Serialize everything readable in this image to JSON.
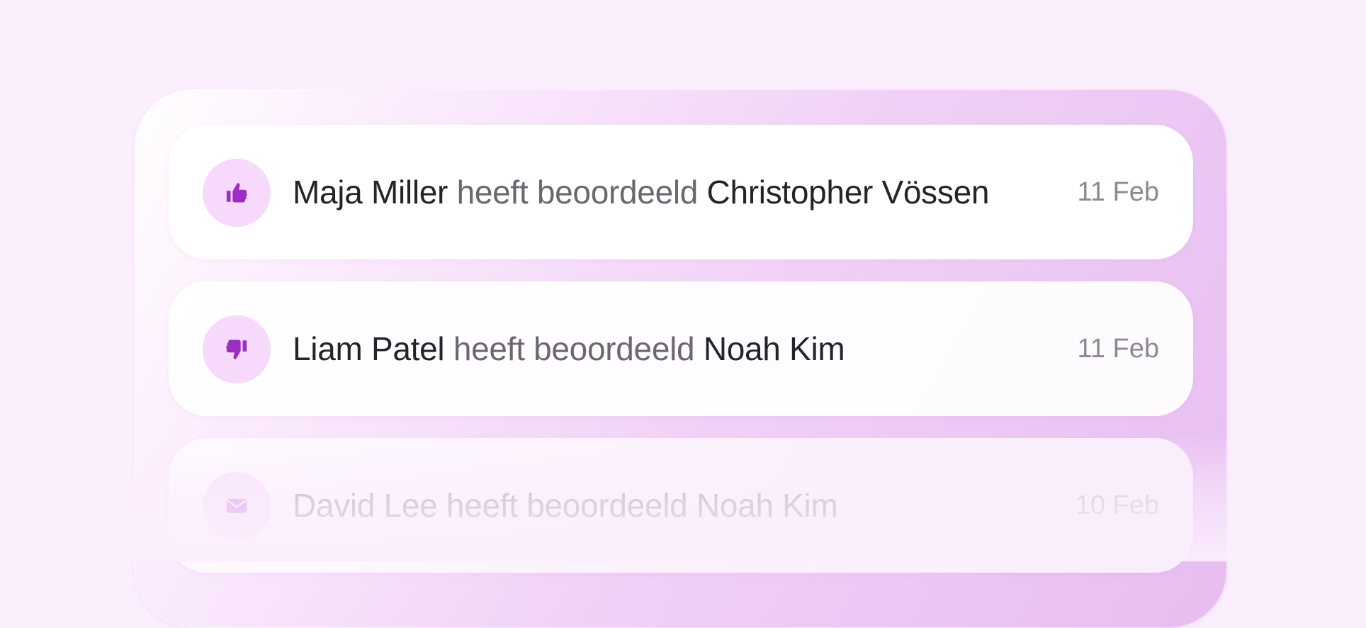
{
  "activity": {
    "items": [
      {
        "icon": "thumbs-up-icon",
        "actor": "Maja Miller",
        "verb": "heeft beoordeeld",
        "target": "Christopher Vössen",
        "date": "11 Feb"
      },
      {
        "icon": "thumbs-down-icon",
        "actor": "Liam Patel",
        "verb": "heeft beoordeeld",
        "target": "Noah Kim",
        "date": "11 Feb"
      },
      {
        "icon": "mail-icon",
        "actor": "David Lee",
        "verb": "heeft beoordeeld",
        "target": "Noah Kim",
        "date": "10 Feb"
      }
    ]
  },
  "colors": {
    "background": "#fbeefd",
    "icon_accent": "#9b2fc1",
    "icon_circle": "#f6d9fb",
    "text_primary": "#27222a",
    "text_secondary": "#6d6670",
    "date_text": "#8f8893"
  }
}
